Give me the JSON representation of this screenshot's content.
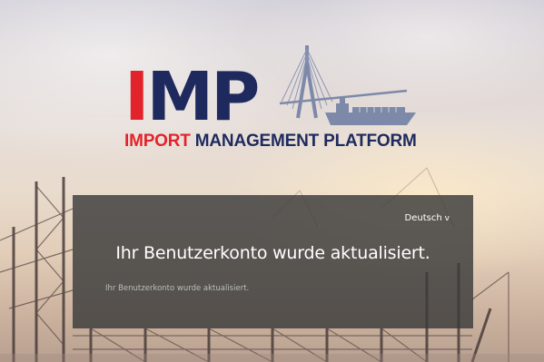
{
  "logo": {
    "letter_i": "I",
    "letters_mp": "MP",
    "tagline_red": "IMPORT",
    "tagline_blue": "MANAGEMENT PLATFORM",
    "colors": {
      "red": "#e3232c",
      "navy": "#1e2a5e",
      "graphic": "#7d89a8"
    },
    "graphic_icon": "bridge-and-ship-icon"
  },
  "panel": {
    "language": "Deutsch",
    "language_icon": "chevron-down-icon",
    "title": "Ihr Benutzerkonto wurde aktualisiert.",
    "message": "Ihr Benutzerkonto wurde aktualisiert."
  }
}
